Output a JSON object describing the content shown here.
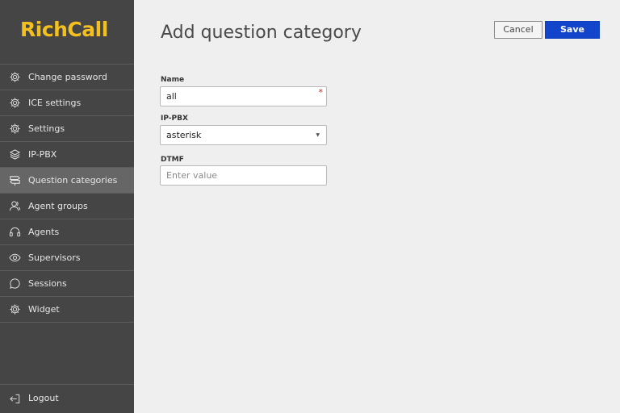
{
  "app": {
    "logo": "RichCall"
  },
  "sidebar": {
    "items": [
      {
        "label": "Change password",
        "icon": "gear-icon",
        "active": false
      },
      {
        "label": "ICE settings",
        "icon": "gear-icon",
        "active": false
      },
      {
        "label": "Settings",
        "icon": "gear-icon",
        "active": false
      },
      {
        "label": "IP-PBX",
        "icon": "layers-icon",
        "active": false
      },
      {
        "label": "Question categories",
        "icon": "signpost-icon",
        "active": true
      },
      {
        "label": "Agent groups",
        "icon": "user-group-icon",
        "active": false
      },
      {
        "label": "Agents",
        "icon": "headset-icon",
        "active": false
      },
      {
        "label": "Supervisors",
        "icon": "eye-icon",
        "active": false
      },
      {
        "label": "Sessions",
        "icon": "chat-bubble-icon",
        "active": false
      },
      {
        "label": "Widget",
        "icon": "gear-icon",
        "active": false
      }
    ],
    "logout": {
      "label": "Logout",
      "icon": "logout-icon"
    }
  },
  "header": {
    "title": "Add question category",
    "cancel_label": "Cancel",
    "save_label": "Save"
  },
  "form": {
    "name": {
      "label": "Name",
      "value": "all",
      "required": true
    },
    "ip_pbx": {
      "label": "IP-PBX",
      "value": "asterisk"
    },
    "dtmf": {
      "label": "DTMF",
      "value": "",
      "placeholder": "Enter value"
    }
  },
  "colors": {
    "sidebar_bg": "#454545",
    "logo": "#f3c01d",
    "save_button": "#1344cc",
    "active_item": "#666666"
  }
}
